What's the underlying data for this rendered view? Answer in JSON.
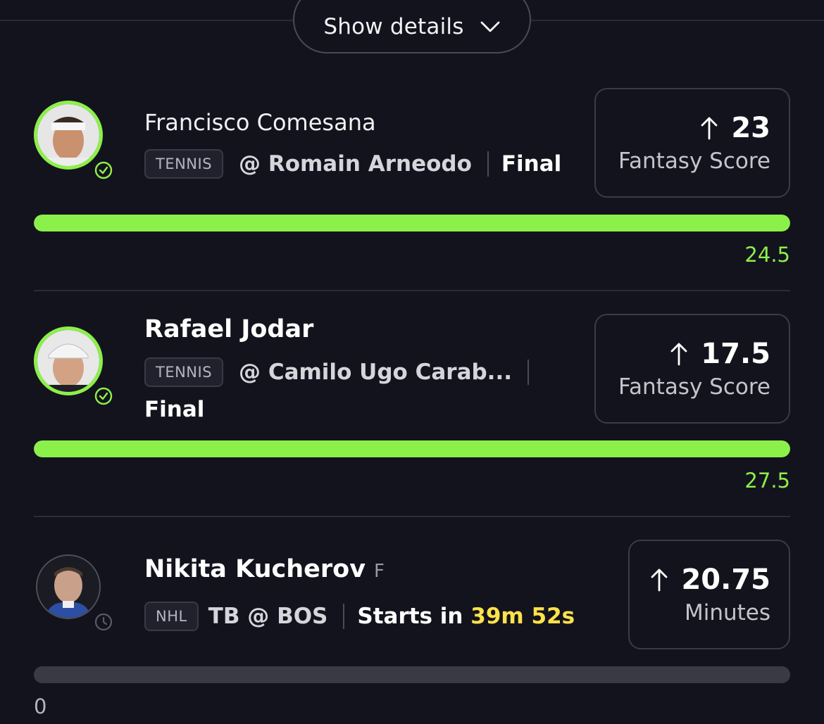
{
  "header": {
    "show_details_label": "Show details"
  },
  "colors": {
    "accent": "#8cf04a",
    "timer": "#ffe24a",
    "background": "#13131d"
  },
  "players": [
    {
      "name": "Francisco Comesana",
      "sport_tag": "TENNIS",
      "opponent": "@ Romain Arneodo",
      "status": "Final",
      "score": "23",
      "stat_label": "Fantasy Score",
      "progress": 1.0,
      "line_value": "24.5",
      "badge_icon": "check-circle-icon"
    },
    {
      "name": "Rafael Jodar",
      "sport_tag": "TENNIS",
      "opponent": "@ Camilo Ugo Carab...",
      "status": "Final",
      "score": "17.5",
      "stat_label": "Fantasy Score",
      "progress": 1.0,
      "line_value": "27.5",
      "badge_icon": "check-circle-icon"
    },
    {
      "name": "Nikita Kucherov",
      "position": "F",
      "sport_tag": "NHL",
      "matchup": "TB @ BOS",
      "status_prefix": "Starts in",
      "countdown": "39m 52s",
      "score": "20.75",
      "stat_label": "Minutes",
      "progress": 0,
      "line_value": "0",
      "badge_icon": "clock-icon"
    }
  ]
}
